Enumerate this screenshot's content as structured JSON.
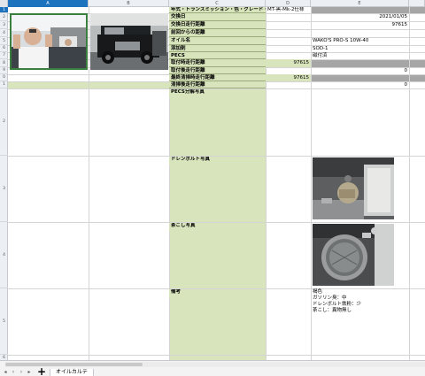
{
  "columns": [
    "A",
    "B",
    "C",
    "D",
    "E"
  ],
  "rows": [
    "1",
    "2",
    "3",
    "4",
    "5",
    "6",
    "7",
    "8",
    "9",
    "0",
    "1",
    "2",
    "3",
    "4",
    "5",
    "6"
  ],
  "labels": {
    "r1": "年式・トランスミッション・色・グレード・特徴",
    "r2": "交換日",
    "r3": "交換日走行距離",
    "r4": "前回からの距離",
    "r5": "オイル名",
    "r6": "添加剤",
    "r7": "PECS",
    "r8": "取付時走行距離",
    "r9": "取付後走行距離",
    "r10": "最終清掃時走行距離",
    "r11": "清掃後走行距離",
    "r12": "PECS分解写真",
    "r13": "ドレンボルト写真",
    "r14": "茶こし写真",
    "r15": "備考"
  },
  "values": {
    "d1": "MT-黒-Mk-2仕様",
    "e2": "2021/01/05",
    "e3": "97615",
    "e5": "WAKO'S PRO-S 10W-40",
    "e6": "SOD-1",
    "e7": "磁付済",
    "d8": "97615",
    "e9": "0",
    "d10": "97615",
    "e11": "0"
  },
  "notes": {
    "line1": "褐色",
    "line2": "ガソリン臭：中",
    "line3": "ドレンボルト鉄粉：少",
    "line4": "茶こし：異物無し"
  },
  "sheet_tab": "オイルカルテ",
  "colors": {
    "label_bg": "#d8e4bc",
    "header_bg": "#eceff3",
    "selected_header": "#1e73be",
    "gray_fill": "#a6a6a6"
  },
  "icons": {
    "first_sheet": "nav-first-icon",
    "prev_sheet": "nav-prev-icon",
    "next_sheet": "nav-next-icon",
    "last_sheet": "nav-last-icon",
    "add_sheet": "plus-icon"
  }
}
